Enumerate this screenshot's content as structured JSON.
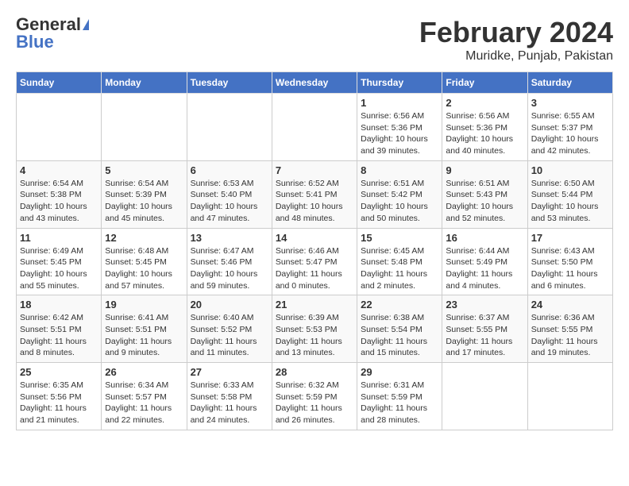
{
  "logo": {
    "general": "General",
    "blue": "Blue"
  },
  "title": "February 2024",
  "subtitle": "Muridke, Punjab, Pakistan",
  "days_of_week": [
    "Sunday",
    "Monday",
    "Tuesday",
    "Wednesday",
    "Thursday",
    "Friday",
    "Saturday"
  ],
  "weeks": [
    [
      {
        "day": "",
        "info": ""
      },
      {
        "day": "",
        "info": ""
      },
      {
        "day": "",
        "info": ""
      },
      {
        "day": "",
        "info": ""
      },
      {
        "day": "1",
        "info": "Sunrise: 6:56 AM\nSunset: 5:36 PM\nDaylight: 10 hours and 39 minutes."
      },
      {
        "day": "2",
        "info": "Sunrise: 6:56 AM\nSunset: 5:36 PM\nDaylight: 10 hours and 40 minutes."
      },
      {
        "day": "3",
        "info": "Sunrise: 6:55 AM\nSunset: 5:37 PM\nDaylight: 10 hours and 42 minutes."
      }
    ],
    [
      {
        "day": "4",
        "info": "Sunrise: 6:54 AM\nSunset: 5:38 PM\nDaylight: 10 hours and 43 minutes."
      },
      {
        "day": "5",
        "info": "Sunrise: 6:54 AM\nSunset: 5:39 PM\nDaylight: 10 hours and 45 minutes."
      },
      {
        "day": "6",
        "info": "Sunrise: 6:53 AM\nSunset: 5:40 PM\nDaylight: 10 hours and 47 minutes."
      },
      {
        "day": "7",
        "info": "Sunrise: 6:52 AM\nSunset: 5:41 PM\nDaylight: 10 hours and 48 minutes."
      },
      {
        "day": "8",
        "info": "Sunrise: 6:51 AM\nSunset: 5:42 PM\nDaylight: 10 hours and 50 minutes."
      },
      {
        "day": "9",
        "info": "Sunrise: 6:51 AM\nSunset: 5:43 PM\nDaylight: 10 hours and 52 minutes."
      },
      {
        "day": "10",
        "info": "Sunrise: 6:50 AM\nSunset: 5:44 PM\nDaylight: 10 hours and 53 minutes."
      }
    ],
    [
      {
        "day": "11",
        "info": "Sunrise: 6:49 AM\nSunset: 5:45 PM\nDaylight: 10 hours and 55 minutes."
      },
      {
        "day": "12",
        "info": "Sunrise: 6:48 AM\nSunset: 5:45 PM\nDaylight: 10 hours and 57 minutes."
      },
      {
        "day": "13",
        "info": "Sunrise: 6:47 AM\nSunset: 5:46 PM\nDaylight: 10 hours and 59 minutes."
      },
      {
        "day": "14",
        "info": "Sunrise: 6:46 AM\nSunset: 5:47 PM\nDaylight: 11 hours and 0 minutes."
      },
      {
        "day": "15",
        "info": "Sunrise: 6:45 AM\nSunset: 5:48 PM\nDaylight: 11 hours and 2 minutes."
      },
      {
        "day": "16",
        "info": "Sunrise: 6:44 AM\nSunset: 5:49 PM\nDaylight: 11 hours and 4 minutes."
      },
      {
        "day": "17",
        "info": "Sunrise: 6:43 AM\nSunset: 5:50 PM\nDaylight: 11 hours and 6 minutes."
      }
    ],
    [
      {
        "day": "18",
        "info": "Sunrise: 6:42 AM\nSunset: 5:51 PM\nDaylight: 11 hours and 8 minutes."
      },
      {
        "day": "19",
        "info": "Sunrise: 6:41 AM\nSunset: 5:51 PM\nDaylight: 11 hours and 9 minutes."
      },
      {
        "day": "20",
        "info": "Sunrise: 6:40 AM\nSunset: 5:52 PM\nDaylight: 11 hours and 11 minutes."
      },
      {
        "day": "21",
        "info": "Sunrise: 6:39 AM\nSunset: 5:53 PM\nDaylight: 11 hours and 13 minutes."
      },
      {
        "day": "22",
        "info": "Sunrise: 6:38 AM\nSunset: 5:54 PM\nDaylight: 11 hours and 15 minutes."
      },
      {
        "day": "23",
        "info": "Sunrise: 6:37 AM\nSunset: 5:55 PM\nDaylight: 11 hours and 17 minutes."
      },
      {
        "day": "24",
        "info": "Sunrise: 6:36 AM\nSunset: 5:55 PM\nDaylight: 11 hours and 19 minutes."
      }
    ],
    [
      {
        "day": "25",
        "info": "Sunrise: 6:35 AM\nSunset: 5:56 PM\nDaylight: 11 hours and 21 minutes."
      },
      {
        "day": "26",
        "info": "Sunrise: 6:34 AM\nSunset: 5:57 PM\nDaylight: 11 hours and 22 minutes."
      },
      {
        "day": "27",
        "info": "Sunrise: 6:33 AM\nSunset: 5:58 PM\nDaylight: 11 hours and 24 minutes."
      },
      {
        "day": "28",
        "info": "Sunrise: 6:32 AM\nSunset: 5:59 PM\nDaylight: 11 hours and 26 minutes."
      },
      {
        "day": "29",
        "info": "Sunrise: 6:31 AM\nSunset: 5:59 PM\nDaylight: 11 hours and 28 minutes."
      },
      {
        "day": "",
        "info": ""
      },
      {
        "day": "",
        "info": ""
      }
    ]
  ]
}
